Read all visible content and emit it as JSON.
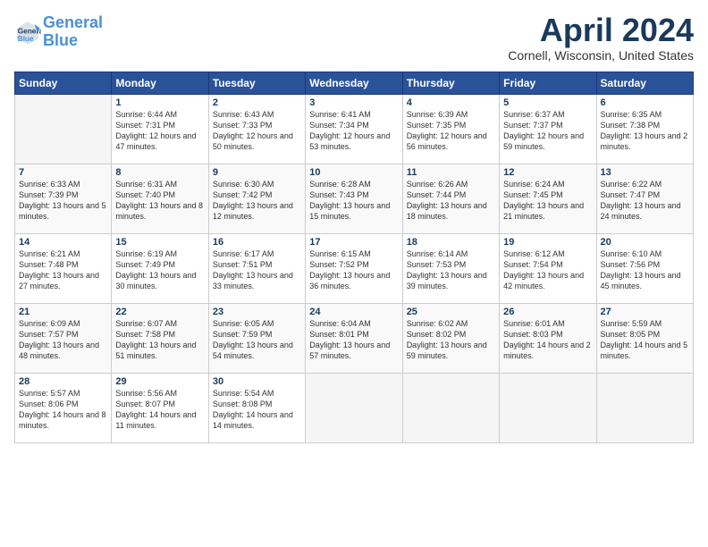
{
  "header": {
    "logo_line1": "General",
    "logo_line2": "Blue",
    "title": "April 2024",
    "location": "Cornell, Wisconsin, United States"
  },
  "days_of_week": [
    "Sunday",
    "Monday",
    "Tuesday",
    "Wednesday",
    "Thursday",
    "Friday",
    "Saturday"
  ],
  "weeks": [
    [
      {
        "day": "",
        "empty": true
      },
      {
        "day": "1",
        "sunrise": "6:44 AM",
        "sunset": "7:31 PM",
        "daylight": "12 hours and 47 minutes."
      },
      {
        "day": "2",
        "sunrise": "6:43 AM",
        "sunset": "7:33 PM",
        "daylight": "12 hours and 50 minutes."
      },
      {
        "day": "3",
        "sunrise": "6:41 AM",
        "sunset": "7:34 PM",
        "daylight": "12 hours and 53 minutes."
      },
      {
        "day": "4",
        "sunrise": "6:39 AM",
        "sunset": "7:35 PM",
        "daylight": "12 hours and 56 minutes."
      },
      {
        "day": "5",
        "sunrise": "6:37 AM",
        "sunset": "7:37 PM",
        "daylight": "12 hours and 59 minutes."
      },
      {
        "day": "6",
        "sunrise": "6:35 AM",
        "sunset": "7:38 PM",
        "daylight": "13 hours and 2 minutes."
      }
    ],
    [
      {
        "day": "7",
        "sunrise": "6:33 AM",
        "sunset": "7:39 PM",
        "daylight": "13 hours and 5 minutes."
      },
      {
        "day": "8",
        "sunrise": "6:31 AM",
        "sunset": "7:40 PM",
        "daylight": "13 hours and 8 minutes."
      },
      {
        "day": "9",
        "sunrise": "6:30 AM",
        "sunset": "7:42 PM",
        "daylight": "13 hours and 12 minutes."
      },
      {
        "day": "10",
        "sunrise": "6:28 AM",
        "sunset": "7:43 PM",
        "daylight": "13 hours and 15 minutes."
      },
      {
        "day": "11",
        "sunrise": "6:26 AM",
        "sunset": "7:44 PM",
        "daylight": "13 hours and 18 minutes."
      },
      {
        "day": "12",
        "sunrise": "6:24 AM",
        "sunset": "7:45 PM",
        "daylight": "13 hours and 21 minutes."
      },
      {
        "day": "13",
        "sunrise": "6:22 AM",
        "sunset": "7:47 PM",
        "daylight": "13 hours and 24 minutes."
      }
    ],
    [
      {
        "day": "14",
        "sunrise": "6:21 AM",
        "sunset": "7:48 PM",
        "daylight": "13 hours and 27 minutes."
      },
      {
        "day": "15",
        "sunrise": "6:19 AM",
        "sunset": "7:49 PM",
        "daylight": "13 hours and 30 minutes."
      },
      {
        "day": "16",
        "sunrise": "6:17 AM",
        "sunset": "7:51 PM",
        "daylight": "13 hours and 33 minutes."
      },
      {
        "day": "17",
        "sunrise": "6:15 AM",
        "sunset": "7:52 PM",
        "daylight": "13 hours and 36 minutes."
      },
      {
        "day": "18",
        "sunrise": "6:14 AM",
        "sunset": "7:53 PM",
        "daylight": "13 hours and 39 minutes."
      },
      {
        "day": "19",
        "sunrise": "6:12 AM",
        "sunset": "7:54 PM",
        "daylight": "13 hours and 42 minutes."
      },
      {
        "day": "20",
        "sunrise": "6:10 AM",
        "sunset": "7:56 PM",
        "daylight": "13 hours and 45 minutes."
      }
    ],
    [
      {
        "day": "21",
        "sunrise": "6:09 AM",
        "sunset": "7:57 PM",
        "daylight": "13 hours and 48 minutes."
      },
      {
        "day": "22",
        "sunrise": "6:07 AM",
        "sunset": "7:58 PM",
        "daylight": "13 hours and 51 minutes."
      },
      {
        "day": "23",
        "sunrise": "6:05 AM",
        "sunset": "7:59 PM",
        "daylight": "13 hours and 54 minutes."
      },
      {
        "day": "24",
        "sunrise": "6:04 AM",
        "sunset": "8:01 PM",
        "daylight": "13 hours and 57 minutes."
      },
      {
        "day": "25",
        "sunrise": "6:02 AM",
        "sunset": "8:02 PM",
        "daylight": "13 hours and 59 minutes."
      },
      {
        "day": "26",
        "sunrise": "6:01 AM",
        "sunset": "8:03 PM",
        "daylight": "14 hours and 2 minutes."
      },
      {
        "day": "27",
        "sunrise": "5:59 AM",
        "sunset": "8:05 PM",
        "daylight": "14 hours and 5 minutes."
      }
    ],
    [
      {
        "day": "28",
        "sunrise": "5:57 AM",
        "sunset": "8:06 PM",
        "daylight": "14 hours and 8 minutes."
      },
      {
        "day": "29",
        "sunrise": "5:56 AM",
        "sunset": "8:07 PM",
        "daylight": "14 hours and 11 minutes."
      },
      {
        "day": "30",
        "sunrise": "5:54 AM",
        "sunset": "8:08 PM",
        "daylight": "14 hours and 14 minutes."
      },
      {
        "day": "",
        "empty": true
      },
      {
        "day": "",
        "empty": true
      },
      {
        "day": "",
        "empty": true
      },
      {
        "day": "",
        "empty": true
      }
    ]
  ]
}
